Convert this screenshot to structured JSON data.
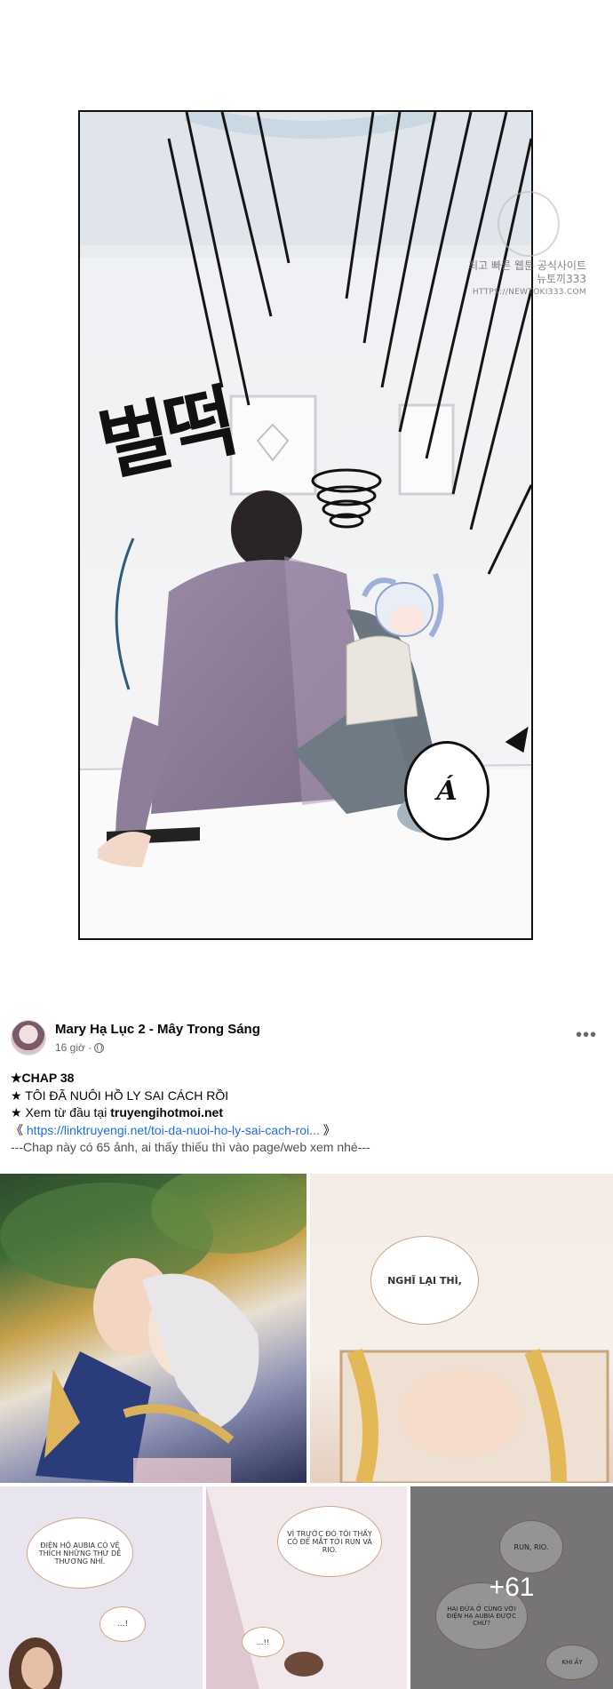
{
  "panel": {
    "sfx_korean": "벌떡",
    "speech_bubble": "Á",
    "watermark_line1": "최고 빠른 웹툰 공식사이트",
    "watermark_line2": "뉴토끼333",
    "watermark_url": "HTTPS://NEWTOKI333.COM"
  },
  "post": {
    "author": "Mary Hạ Lục 2 - Mây Trong Sáng",
    "time": "16 giờ ·",
    "more_label": "•••",
    "lines": {
      "chap": "★CHAP 38",
      "title": "★ TÔI ĐÃ NUÔI HỒ LY SAI CÁCH RỒI",
      "read_from_prefix": "★ Xem từ đầu tại ",
      "read_from_site": "truyengihotmoi.net",
      "link_open": "《 ",
      "link_url": "https://linktruyengi.net/toi-da-nuoi-ho-ly-sai-cach-roi...",
      "link_close": " 》",
      "note": "---Chap này có 65 ảnh, ai thấy thiếu thì vào page/web xem nhé---"
    }
  },
  "photos": {
    "p2_bubble": "NGHĨ LẠI THÌ,",
    "p3_bubble1": "ĐIỆN HỘ AUBIA CÓ VẺ THÍCH NHỮNG THỨ DỄ THƯƠNG NHỈ.",
    "p3_bubble2": "...!",
    "p4_bubble1": "VÌ TRƯỚC ĐÓ TÔI THẤY CÔ ĐỂ MẮT TỚI RUN VÀ RIO.",
    "p4_bubble2": "...!!",
    "p5_bubble1": "RUN, RIO.",
    "p5_bubble2": "HAI ĐỨA Ở CÙNG VỚI ĐIỆN HẠ AUBIA ĐƯỢC CHỨ?",
    "p5_bubble3": "KHI ẤY",
    "more_count": "+61"
  }
}
